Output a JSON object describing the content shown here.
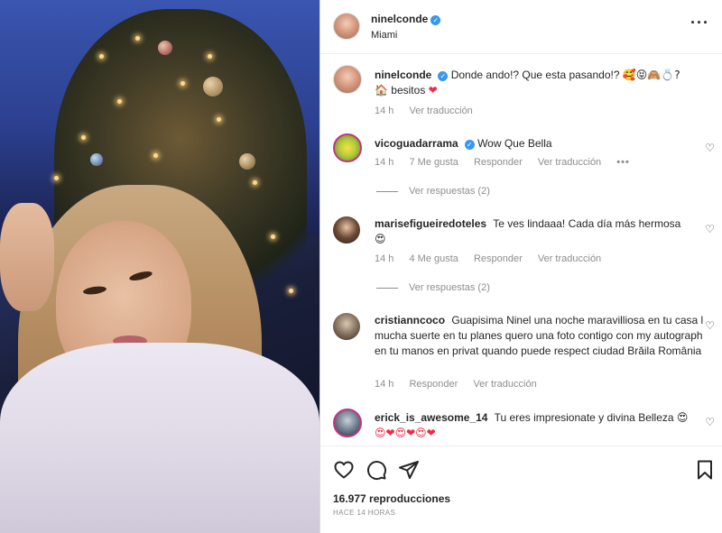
{
  "post": {
    "author": "ninelconde",
    "location": "Miami",
    "more_icon": "more-horizontal-icon"
  },
  "caption": {
    "user": "ninelconde",
    "text": "Donde ando!? Que esta pasando!?",
    "emojis": "🥰😝🙈💍?",
    "line2_emoji": "🏠",
    "line2_text": "besitos",
    "line2_end": "❤",
    "time": "14 h",
    "translate": "Ver traducción"
  },
  "comments": [
    {
      "user": "vicoguadarrama",
      "verified": true,
      "text": "Wow Que Bella",
      "time": "14 h",
      "likes": "7 Me gusta",
      "reply": "Responder",
      "translate": "Ver traducción",
      "more": "•••",
      "replies": "Ver respuestas (2)"
    },
    {
      "user": "marisefigueiredoteles",
      "text": "Te ves lindaaa! Cada día más hermosa",
      "emoji": "😍",
      "time": "14 h",
      "likes": "4 Me gusta",
      "reply": "Responder",
      "translate": "Ver traducción",
      "replies": "Ver respuestas (2)"
    },
    {
      "user": "cristianncoco",
      "text": "Guapisima Ninel una noche maravilliosa en tu casa l mucha suerte en tu planes quero una foto contigo con my autograph en tu manos en privat quando puede respect ciudad Brăila România",
      "time": "14 h",
      "reply": "Responder",
      "translate": "Ver traducción"
    },
    {
      "user": "erick_is_awesome_14",
      "text": "Tu eres impresionate y divina Belleza",
      "emoji": "😍",
      "emojis2": "😍❤😍❤😍❤"
    }
  ],
  "actions": {
    "views": "16.977 reproducciones",
    "time": "HACE 14 HORAS"
  },
  "colors": {
    "verified": "#3897f0",
    "muted": "#8e8e8e",
    "text": "#262626",
    "heart_red": "#ed2b4a"
  }
}
